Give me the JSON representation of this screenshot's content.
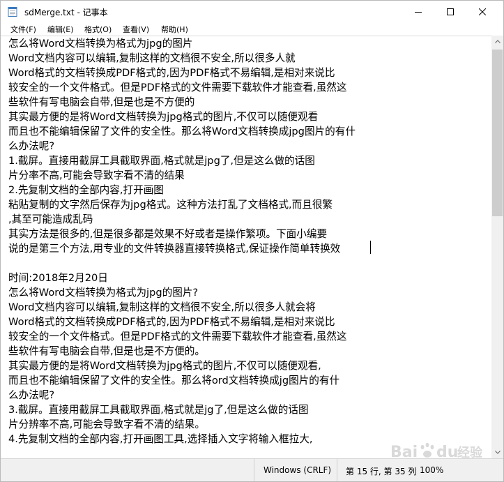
{
  "window": {
    "title": "sdMerge.txt - 记事本"
  },
  "menu": [
    {
      "id": "file",
      "label": "文件(F)"
    },
    {
      "id": "edit",
      "label": "编辑(E)"
    },
    {
      "id": "format",
      "label": "格式(O)"
    },
    {
      "id": "view",
      "label": "查看(V)"
    },
    {
      "id": "help",
      "label": "帮助(H)"
    }
  ],
  "document": {
    "lines": [
      "怎么将Word文档转换为格式为jpg的图片",
      "Word文档内容可以编辑,复制这样的文档很不安全,所以很多人就",
      "Word格式的文档转换成PDF格式的,因为PDF格式不易编辑,是相对来说比",
      "较安全的一个文件格式。但是PDF格式的文件需要下载软件才能查看,虽然这",
      "些软件有写电脑会自带,但是也是不方便的",
      "其实最方便的是将Word文档转换为jpg格式的图片,不仅可以随便观看",
      "而且也不能编辑保留了文件的安全性。那么将Word文档转换成jpg图片的有什",
      "么办法呢?",
      "1.截屏。直接用截屏工具截取界面,格式就是jpg了,但是这么做的话图",
      "片分率不高,可能会导致字看不清的结果",
      "2.先复制文档的全部内容,打开画图",
      "粘贴复制的文字然后保存为jpg格式。这种方法打乱了文档格式,而且很繁",
      ",其至可能造成乱码",
      "其实方法是很多的,但是很多都是效果不好或者是操作繁项。下面小编要",
      "说的是第三个方法,用专业的文件转换器直接转换格式,保证操作简单转换效",
      "",
      "时间:2018年2月20日",
      "怎么将Word文档转换为格式为jpg的图片?",
      "Word文档内容可以编辑,复制这样的文档很不安全,所以很多人就会将",
      "Word格式的文档转换成PDF格式的,因为PDF格式不易编辑,是相对来说比",
      "较安全的一个文件格式。但是PDF格式的文件需要下载软件才能查看,虽然这",
      "些软件有写电脑会自带,但是也是不方便的。",
      "其实最方便的是将Word文档转换为jpg格式的图片,不仅可以随便观看,",
      "而且也不能编辑保留了文件的安全性。那么将ord文档转换成jg图片的有什",
      "么办法呢?",
      "3.截屏。直接用截屏工具截取界面,格式就是jg了,但是这么做的话图",
      "片分辨率不高,可能会导致字看不清的结果。",
      "4.先复制文档的全部内容,打开画图工具,选择插入文字将输入框拉大,"
    ]
  },
  "status": {
    "encoding": "Windows (CRLF)",
    "position": "第 15 行, 第 35 列",
    "zoom": "100%"
  },
  "watermark": {
    "text": "Baidu经验"
  }
}
